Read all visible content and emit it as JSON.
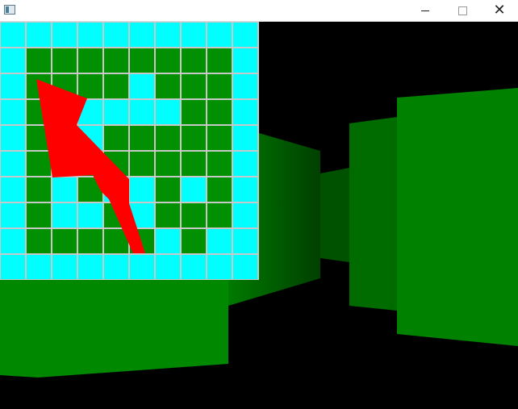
{
  "window": {
    "title": "",
    "minimize_icon": "minimize-icon",
    "maximize_icon": "maximize-icon",
    "close_icon": "close-icon"
  },
  "colors": {
    "wall_light": "#008800",
    "wall_mid": "#007000",
    "wall_dark": "#004400",
    "map_open": "#00ffff",
    "map_wall": "#009000",
    "map_grid": "#c8c8c8",
    "player_arrow": "#ff0000",
    "background": "#000000"
  },
  "minimap": {
    "rows": 10,
    "cols": 10,
    "grid": [
      "0000000000",
      "0111111110",
      "0111101110",
      "0100000110",
      "0110111110",
      "0111111110",
      "0101001010",
      "0100101110",
      "0111110100",
      "0000000000"
    ],
    "legend": {
      "0": "open",
      "1": "wall"
    },
    "player_heading": "up-left"
  }
}
